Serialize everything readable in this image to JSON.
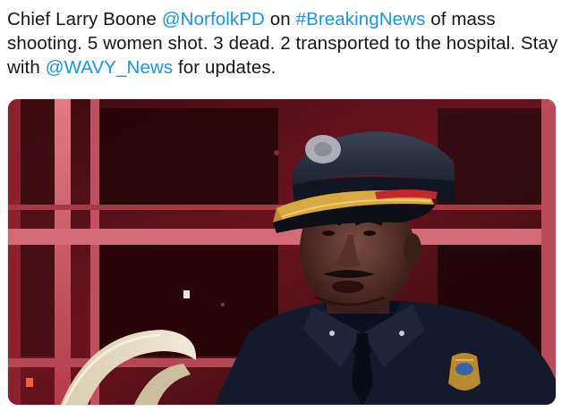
{
  "tweet": {
    "segments": [
      {
        "type": "text",
        "value": "Chief Larry Boone "
      },
      {
        "type": "mention",
        "value": "@NorfolkPD"
      },
      {
        "type": "text",
        "value": " on "
      },
      {
        "type": "hashtag",
        "value": "#BreakingNews"
      },
      {
        "type": "text",
        "value": " of mass shooting. 5 women shot. 3 dead. 2 transported to the hospital. Stay with "
      },
      {
        "type": "mention",
        "value": "@WAVY_News"
      },
      {
        "type": "text",
        "value": " for updates."
      }
    ]
  },
  "media": {
    "kind": "video-still"
  },
  "colors": {
    "text": "#14171a",
    "link": "#1b95e0",
    "border": "#e1e8ed",
    "scene_red": "#c2262e",
    "uniform": "#141a2b"
  }
}
